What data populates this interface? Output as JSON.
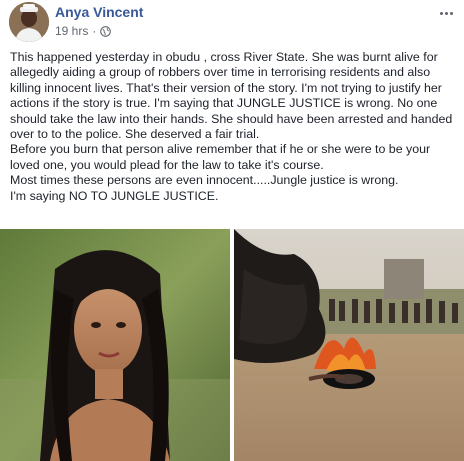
{
  "post": {
    "author": "Anya Vincent",
    "time": "19 hrs",
    "separator": "·",
    "paragraphs": [
      "This happened yesterday in obudu , cross River State. She was burnt alive for allegedly aiding a group of robbers over time in terrorising residents and also killing innocent lives. That's their version of the story. I'm not trying to justify her actions if the story is true. I'm saying that JUNGLE JUSTICE is wrong. No one should take the law into their hands. She should have been arrested and handed over to to the police. She deserved a fair trial.",
      "Before you burn that person alive remember that if he or she were to be your loved one, you would plead for the law to take it's course.",
      "Most times these persons are even innocent.....Jungle justice is wrong.",
      "I'm saying NO TO JUNGLE JUSTICE."
    ]
  },
  "icons": {
    "avatar": "profile-avatar",
    "privacy": "globe-icon",
    "menu": "more-options-icon"
  },
  "colors": {
    "author_link": "#385898",
    "meta_text": "#616770",
    "body_text": "#1d2129"
  }
}
